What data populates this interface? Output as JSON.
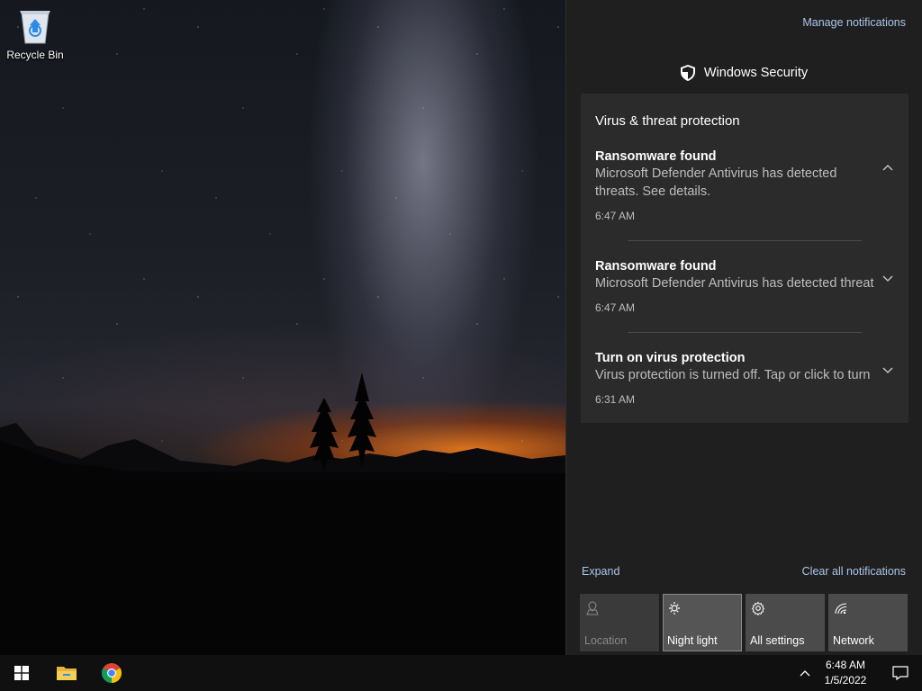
{
  "desktop": {
    "icons": [
      {
        "label": "Recycle Bin",
        "icon": "recycle-bin-icon"
      }
    ]
  },
  "action_center": {
    "manage_label": "Manage notifications",
    "app_name": "Windows Security",
    "app_icon": "shield-icon",
    "group_title": "Virus & threat protection",
    "notifications": [
      {
        "title": "Ransomware found",
        "body": "Microsoft Defender Antivirus has detected threats.  See details.",
        "time": "6:47 AM",
        "chevron": "chevron-up-icon"
      },
      {
        "title": "Ransomware found",
        "body": "Microsoft Defender Antivirus has detected threats.  See details.",
        "time": "6:47 AM",
        "chevron": "chevron-down-icon"
      },
      {
        "title": "Turn on virus protection",
        "body": "Virus protection is turned off. Tap or click to turn on.",
        "time": "6:31 AM",
        "chevron": "chevron-down-icon"
      }
    ],
    "expand_label": "Expand",
    "clear_label": "Clear all notifications",
    "quick_actions": [
      {
        "label": "Location",
        "icon": "location-icon",
        "state": "disabled"
      },
      {
        "label": "Night light",
        "icon": "night-light-icon",
        "state": "active"
      },
      {
        "label": "All settings",
        "icon": "gear-icon",
        "state": "normal"
      },
      {
        "label": "Network",
        "icon": "network-icon",
        "state": "normal"
      }
    ]
  },
  "taskbar": {
    "start_icon": "windows-logo-icon",
    "pinned": [
      {
        "name": "File Explorer",
        "icon": "file-explorer-icon"
      },
      {
        "name": "Google Chrome",
        "icon": "chrome-icon"
      }
    ],
    "time": "6:48 AM",
    "date": "1/5/2022"
  },
  "colors": {
    "panel_bg": "#1f1f1f",
    "card_bg": "#2b2b2b",
    "link": "#a9c7e8",
    "taskbar_bg": "#101010"
  }
}
